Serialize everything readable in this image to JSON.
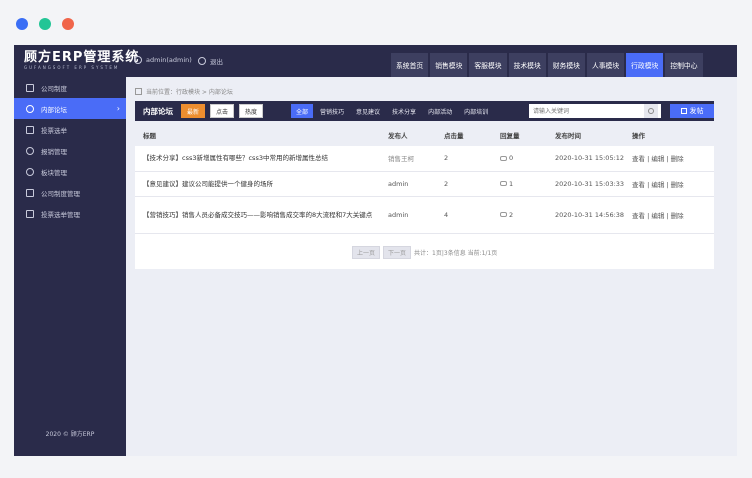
{
  "window_dots": [
    {
      "color": "#3a6ef5"
    },
    {
      "color": "#23c596"
    },
    {
      "color": "#f0654a"
    }
  ],
  "header": {
    "logo_title": "顾方ERP管理系统",
    "logo_subtitle": "GUFANGSOFT ERP SYSTEM",
    "user_label": "admin(admin)",
    "logout_label": "退出",
    "nav": [
      "系统首页",
      "销售模块",
      "客服模块",
      "技术模块",
      "财务模块",
      "人事模块",
      "行政模块",
      "控制中心"
    ],
    "active_nav": "行政模块"
  },
  "sidebar": {
    "items": [
      {
        "label": "公司制度"
      },
      {
        "label": "内部论坛"
      },
      {
        "label": "投票选举"
      },
      {
        "label": "报销管理"
      },
      {
        "label": "板块管理"
      },
      {
        "label": "公司制度管理"
      },
      {
        "label": "投票选举管理"
      }
    ],
    "active": "内部论坛",
    "chevron": "›",
    "copyright": "2020 © 顾方ERP"
  },
  "breadcrumb": "当前位置：行政模块 > 内部论坛",
  "toolbar": {
    "title": "内部论坛",
    "sort": [
      "最新",
      "点击",
      "热度"
    ],
    "active_sort": "最新",
    "categories": [
      "全部",
      "营销技巧",
      "意见建议",
      "技术分享",
      "内部活动",
      "内部培训"
    ],
    "active_category": "全部",
    "search_placeholder": "请输入关键词",
    "post_label": "发帖"
  },
  "table": {
    "headers": [
      "标题",
      "发布人",
      "点击量",
      "回复量",
      "发布时间",
      "操作"
    ],
    "rows": [
      {
        "title": "【技术分享】css3新增属性有哪些？css3中常用的新增属性总结",
        "author": "销售王柯",
        "clicks": "2",
        "replies": "0",
        "time": "2020-10-31 15:05:12",
        "actions": "查看 | 编辑 | 删除"
      },
      {
        "title": "【意见建议】建议公司能提供一个健身的场所",
        "author": "admin",
        "clicks": "2",
        "replies": "1",
        "time": "2020-10-31 15:03:33",
        "actions": "查看 | 编辑 | 删除"
      },
      {
        "title": "【营销技巧】销售人员必备成交技巧——影响销售成交率的8大流程和7大关键点",
        "author": "admin",
        "clicks": "4",
        "replies": "2",
        "time": "2020-10-31 14:56:38",
        "actions": "查看 | 编辑 | 删除"
      }
    ]
  },
  "pager": {
    "prev": "上一页",
    "next": "下一页",
    "summary": "共计：1页|3条信息  当前:1/1页"
  },
  "colors": {
    "accent": "#4a6cf7",
    "dark": "#2a2b4a",
    "sort_active": "#ee8e2f"
  }
}
